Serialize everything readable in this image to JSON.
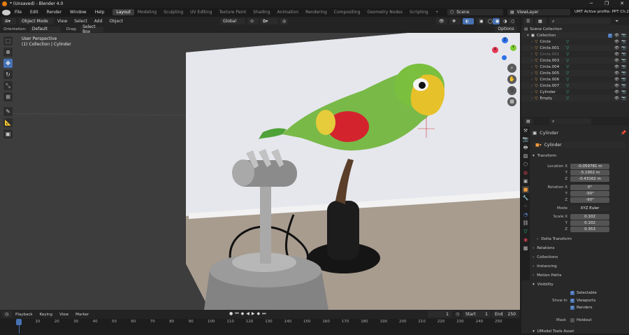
{
  "window": {
    "title": "* (Unsaved) - Blender 4.0",
    "minimize": "─",
    "maximize": "❐",
    "close": "✕"
  },
  "menu": [
    "File",
    "Edit",
    "Render",
    "Window",
    "Help"
  ],
  "workspaces": [
    "Layout",
    "Modeling",
    "Sculpting",
    "UV Editing",
    "Texture Paint",
    "Shading",
    "Animation",
    "Rendering",
    "Compositing",
    "Geometry Nodes",
    "Scripting",
    "+"
  ],
  "active_workspace": "Layout",
  "scene": {
    "label": "Scene",
    "viewlayer": "ViewLayer",
    "profile": "UMT Active profile: PPT Ch.2"
  },
  "viewport_header": {
    "mode": "Object Mode",
    "menus": [
      "View",
      "Select",
      "Add",
      "Object"
    ],
    "transform": "Global"
  },
  "tool_settings": {
    "orientation_label": "Orientation:",
    "orientation_value": "Default",
    "drag_label": "Drag:",
    "drag_value": "Select Box",
    "options": "Options"
  },
  "viewport": {
    "view_name": "User Perspective",
    "collection_info": "(1) Collection | Cylinder",
    "gizmo": {
      "x": "X",
      "y": "Y",
      "z": "Z"
    }
  },
  "outliner": {
    "root": "Scene Collection",
    "collection": "Collection",
    "items": [
      {
        "name": "Circle",
        "dim": false,
        "color": "#e0a050"
      },
      {
        "name": "Circle.001",
        "dim": false,
        "color": "#e0a050"
      },
      {
        "name": "Circle.002",
        "dim": true,
        "color": "#e0a050"
      },
      {
        "name": "Circle.003",
        "dim": false,
        "color": "#e0a050"
      },
      {
        "name": "Circle.004",
        "dim": false,
        "color": "#e0a050"
      },
      {
        "name": "Circle.005",
        "dim": false,
        "color": "#e0a050"
      },
      {
        "name": "Circle.006",
        "dim": false,
        "color": "#e0a050"
      },
      {
        "name": "Circle.007",
        "dim": false,
        "color": "#e0a050"
      },
      {
        "name": "Cylinder",
        "dim": false,
        "color": "#e0a050"
      },
      {
        "name": "Empty",
        "dim": false,
        "color": "#e0a050"
      }
    ]
  },
  "properties": {
    "object_name": "Cylinder",
    "data_name": "Cylinder",
    "transform_label": "Transform",
    "location": {
      "label": "Location X",
      "x": "-0.059781 m",
      "y": "-5.1902 m",
      "z": "-0.43162 m"
    },
    "rotation": {
      "label": "Rotation X",
      "x": "0°",
      "y": "-90°",
      "z": "-90°"
    },
    "mode": {
      "label": "Mode",
      "value": "XYZ Euler"
    },
    "scale": {
      "label": "Scale X",
      "x": "0.102",
      "y": "0.102",
      "z": "0.353"
    },
    "y_label": "Y",
    "z_label": "Z",
    "sections": [
      "Delta Transform",
      "Relations",
      "Collections",
      "Instancing",
      "Motion Paths",
      "Visibility"
    ],
    "visibility": {
      "selectable": "Selectable",
      "show_in": "Show In",
      "viewports": "Viewports",
      "renders": "Renders",
      "mask": "Mask",
      "holdout": "Holdout"
    },
    "footer_section": "UModel Tools Asset"
  },
  "timeline": {
    "menus": [
      "Playback",
      "Keying",
      "View",
      "Marker"
    ],
    "current_frame": "1",
    "start_label": "Start",
    "start": "1",
    "end_label": "End",
    "end": "250",
    "ticks": [
      "0",
      "10",
      "20",
      "30",
      "40",
      "50",
      "60",
      "70",
      "80",
      "90",
      "100",
      "110",
      "120",
      "130",
      "140",
      "150",
      "160",
      "170",
      "180",
      "190",
      "200",
      "210",
      "220",
      "230",
      "240",
      "250"
    ]
  },
  "colors": {
    "accent": "#4772b3",
    "header": "#232323",
    "viewport_bg": "#3d3d3d",
    "panel": "#282828"
  }
}
